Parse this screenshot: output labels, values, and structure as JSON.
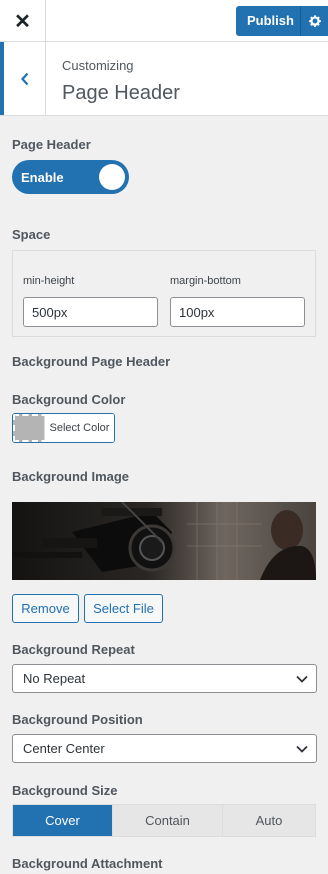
{
  "topbar": {
    "close_glyph": "✕",
    "publish_label": "Publish",
    "settings_icon": "gear-icon"
  },
  "section": {
    "crumb": "Customizing",
    "title": "Page Header"
  },
  "page_header": {
    "label": "Page Header",
    "toggle_label": "Enable",
    "toggle_on": true
  },
  "space": {
    "label": "Space",
    "min_height_label": "min-height",
    "min_height_value": "500px",
    "margin_bottom_label": "margin-bottom",
    "margin_bottom_value": "100px"
  },
  "background_heading": "Background Page Header",
  "background_color": {
    "label": "Background Color",
    "button_label": "Select Color",
    "swatch_color": "#b4b4b4"
  },
  "background_image": {
    "label": "Background Image",
    "remove_label": "Remove",
    "select_label": "Select File"
  },
  "background_repeat": {
    "label": "Background Repeat",
    "value": "No Repeat"
  },
  "background_position": {
    "label": "Background Position",
    "value": "Center Center"
  },
  "background_size": {
    "label": "Background Size",
    "options": [
      "Cover",
      "Contain",
      "Auto"
    ],
    "selected": "Cover"
  },
  "background_attachment": {
    "label": "Background Attachment"
  },
  "colors": {
    "accent": "#2271b1",
    "panel_bg": "#f0f0f1"
  }
}
